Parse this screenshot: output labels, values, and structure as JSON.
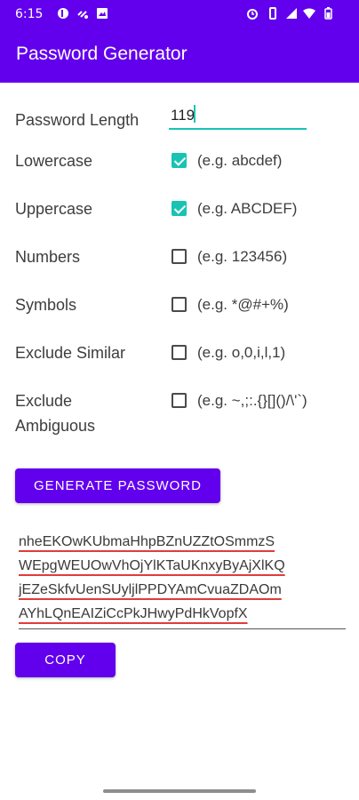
{
  "status_bar": {
    "time": "6:15"
  },
  "app_bar": {
    "title": "Password Generator"
  },
  "length": {
    "label": "Password Length",
    "value": "119"
  },
  "options": [
    {
      "label": "Lowercase",
      "hint": "(e.g. abcdef)",
      "checked": true
    },
    {
      "label": "Uppercase",
      "hint": "(e.g. ABCDEF)",
      "checked": true
    },
    {
      "label": "Numbers",
      "hint": "(e.g. 123456)",
      "checked": false
    },
    {
      "label": "Symbols",
      "hint": "(e.g. *@#+%)",
      "checked": false
    },
    {
      "label": "Exclude Similar",
      "hint": "(e.g. o,0,i,l,1)",
      "checked": false
    },
    {
      "label_line1": "Exclude",
      "label_line2": "Ambiguous",
      "hint": "(e.g. ~,;:.{}[]()/\\'`)",
      "checked": false
    }
  ],
  "generate_button": "GENERATE PASSWORD",
  "password": {
    "lines": [
      "nheEKOwKUbmaHhpBZnUZZtOSmmzS",
      "WEpgWEUOwVhOjYlKTaUKnxyByAjXlKQ",
      "jEZeSkfvUenSUyljlPPDYAmCvuaZDAOm",
      "AYhLQnEAIZiCcPkJHwyPdHkVopfX"
    ]
  },
  "copy_button": "COPY",
  "colors": {
    "primary": "#6200ee",
    "accent": "#18c3b4",
    "spell_underline": "#e23b3b"
  }
}
